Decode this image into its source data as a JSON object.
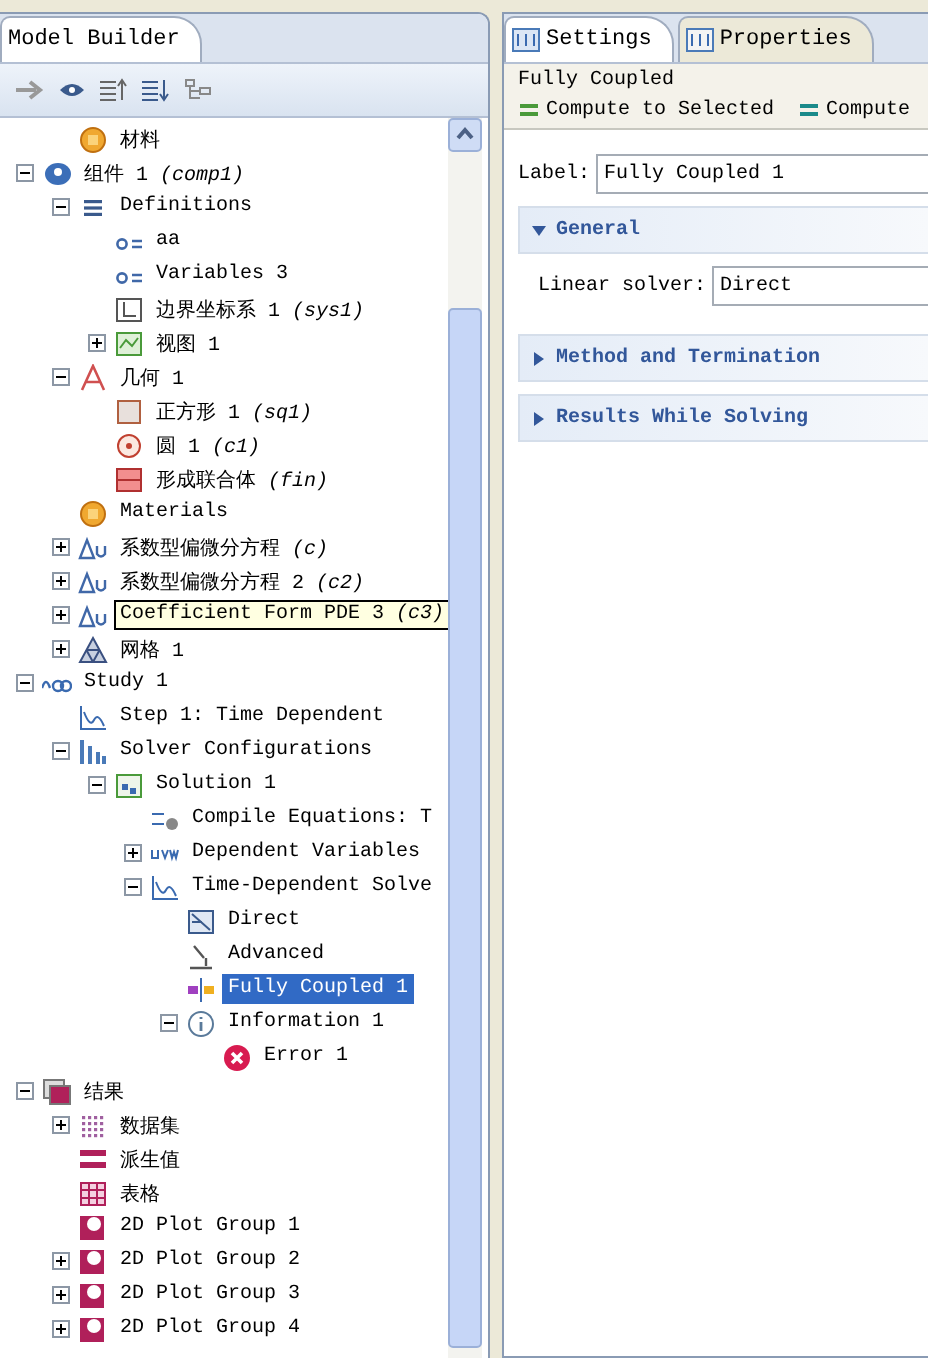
{
  "left_panel": {
    "title": "Model Builder"
  },
  "tree": {
    "orphans": [
      {
        "label": "材料",
        "kind": "materials",
        "selected": false,
        "hovered": false
      }
    ],
    "items": [
      {
        "label": "组件 1",
        "tag": "(comp1)",
        "kind": "component",
        "expanded": true,
        "selected": false,
        "hovered": false,
        "children": [
          {
            "label": "Definitions",
            "kind": "list",
            "expanded": true,
            "selected": false,
            "hovered": false,
            "children": [
              {
                "label": "aa",
                "kind": "variable",
                "selected": false,
                "hovered": false
              },
              {
                "label": "Variables 3",
                "kind": "variable",
                "selected": false,
                "hovered": false
              },
              {
                "label": "边界坐标系 1",
                "tag": "(sys1)",
                "kind": "coords",
                "selected": false,
                "hovered": false
              },
              {
                "label": "视图 1",
                "kind": "view",
                "expanded": false,
                "selected": false,
                "hovered": false
              }
            ]
          },
          {
            "label": "几何 1",
            "kind": "geometry",
            "expanded": true,
            "selected": false,
            "hovered": false,
            "children": [
              {
                "label": "正方形 1",
                "tag": "(sq1)",
                "kind": "square",
                "selected": false,
                "hovered": false
              },
              {
                "label": "圆 1",
                "tag": "(c1)",
                "kind": "circle",
                "selected": false,
                "hovered": false
              },
              {
                "label": "形成联合体",
                "tag": "(fin)",
                "kind": "union",
                "selected": false,
                "hovered": false
              }
            ]
          },
          {
            "label": "Materials",
            "kind": "materials",
            "selected": false,
            "hovered": false
          },
          {
            "label": "系数型偏微分方程",
            "tag": "(c)",
            "kind": "pde",
            "expanded": false,
            "selected": false,
            "hovered": false
          },
          {
            "label": "系数型偏微分方程 2",
            "tag": "(c2)",
            "kind": "pde",
            "expanded": false,
            "selected": false,
            "hovered": false
          },
          {
            "label": "Coefficient Form PDE 3",
            "tag": "(c3)",
            "kind": "pde",
            "expanded": false,
            "selected": false,
            "hovered": true
          },
          {
            "label": "网格 1",
            "kind": "mesh",
            "expanded": false,
            "selected": false,
            "hovered": false
          }
        ]
      },
      {
        "label": "Study 1",
        "kind": "study",
        "expanded": true,
        "selected": false,
        "hovered": false,
        "children": [
          {
            "label": "Step 1: Time Dependent",
            "kind": "step",
            "selected": false,
            "hovered": false
          },
          {
            "label": "Solver Configurations",
            "kind": "solver",
            "expanded": true,
            "selected": false,
            "hovered": false,
            "children": [
              {
                "label": "Solution 1",
                "kind": "solution",
                "expanded": true,
                "selected": false,
                "hovered": false,
                "children": [
                  {
                    "label": "Compile Equations: T",
                    "kind": "compile",
                    "selected": false,
                    "hovered": false
                  },
                  {
                    "label": "Dependent Variables",
                    "kind": "uvw",
                    "expanded": false,
                    "selected": false,
                    "hovered": false
                  },
                  {
                    "label": "Time-Dependent Solve",
                    "kind": "step",
                    "expanded": true,
                    "selected": false,
                    "hovered": false,
                    "children": [
                      {
                        "label": "Direct",
                        "kind": "direct",
                        "selected": false,
                        "hovered": false
                      },
                      {
                        "label": "Advanced",
                        "kind": "advanced",
                        "selected": false,
                        "hovered": false
                      },
                      {
                        "label": "Fully Coupled 1",
                        "kind": "coupled",
                        "selected": true,
                        "hovered": false
                      },
                      {
                        "label": "Information 1",
                        "kind": "info",
                        "expanded": true,
                        "selected": false,
                        "hovered": false,
                        "children": [
                          {
                            "label": "Error 1",
                            "kind": "error",
                            "selected": false,
                            "hovered": false
                          }
                        ]
                      }
                    ]
                  }
                ]
              }
            ]
          }
        ]
      },
      {
        "label": "结果",
        "kind": "results",
        "expanded": true,
        "selected": false,
        "hovered": false,
        "children": [
          {
            "label": "数据集",
            "kind": "dataset",
            "expanded": false,
            "selected": false,
            "hovered": false
          },
          {
            "label": "派生值",
            "kind": "derived",
            "selected": false,
            "hovered": false
          },
          {
            "label": "表格",
            "kind": "table",
            "selected": false,
            "hovered": false
          },
          {
            "label": "2D Plot Group 1",
            "kind": "plot",
            "selected": false,
            "hovered": false
          },
          {
            "label": "2D Plot Group 2",
            "kind": "plot",
            "expanded": false,
            "selected": false,
            "hovered": false
          },
          {
            "label": "2D Plot Group 3",
            "kind": "plot",
            "expanded": false,
            "selected": false,
            "hovered": false
          },
          {
            "label": "2D Plot Group 4",
            "kind": "plot",
            "expanded": false,
            "selected": false,
            "hovered": false
          }
        ]
      }
    ]
  },
  "right_panel": {
    "tabs": [
      {
        "label": "Settings",
        "selected": true
      },
      {
        "label": "Properties",
        "selected": false
      }
    ],
    "heading": "Fully Coupled",
    "toolbar": [
      "Compute to Selected",
      "Compute"
    ],
    "label_field": {
      "label": "Label:",
      "value": "Fully Coupled 1"
    },
    "sections": [
      {
        "title": "General",
        "expanded": true,
        "fields": [
          {
            "label": "Linear solver:",
            "value": "Direct"
          }
        ]
      },
      {
        "title": "Method and Termination",
        "expanded": false
      },
      {
        "title": "Results While Solving",
        "expanded": false
      }
    ]
  }
}
